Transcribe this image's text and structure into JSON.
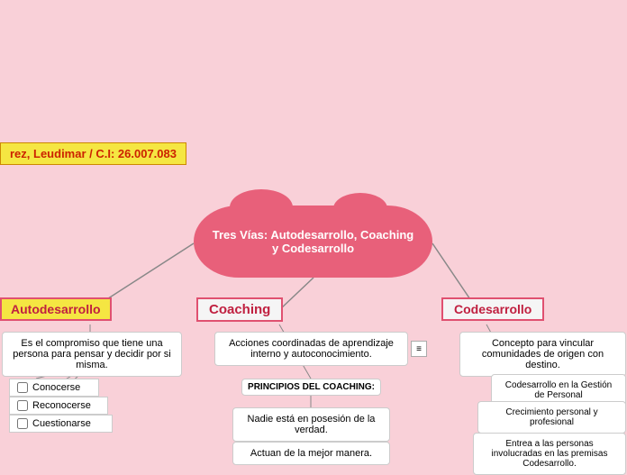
{
  "header": {
    "label": "rez, Leudimar / C.I: 26.007.083"
  },
  "central": {
    "title": "Tres Vías: Autodesarrollo, Coaching y Codesarrollo"
  },
  "autodesarrollo": {
    "title": "Autodesarrollo",
    "description": "Es el compromiso que tiene una persona para pensar y decidir por si misma.",
    "checkboxes": [
      "Conocerse",
      "Reconocerse",
      "Cuestionarse"
    ]
  },
  "coaching": {
    "title": "Coaching",
    "main_box": "Acciones coordinadas de aprendizaje interno y autoconocimiento.",
    "principios": "PRINCIPIOS DEL COACHING:",
    "items": [
      "Nadie está en posesión de la verdad.",
      "Actuan de la mejor manera."
    ]
  },
  "codesarrollo": {
    "title": "Codesarrollo",
    "main_box": "Concepto para vincular comunidades de origen con destino.",
    "items": [
      "Codesarrollo en la Gestión de Personal",
      "Crecimiento personal y profesional",
      "Entrea a las personas involucradas en las premisas Codesarrollo."
    ]
  },
  "icons": {
    "expand": "≡"
  }
}
